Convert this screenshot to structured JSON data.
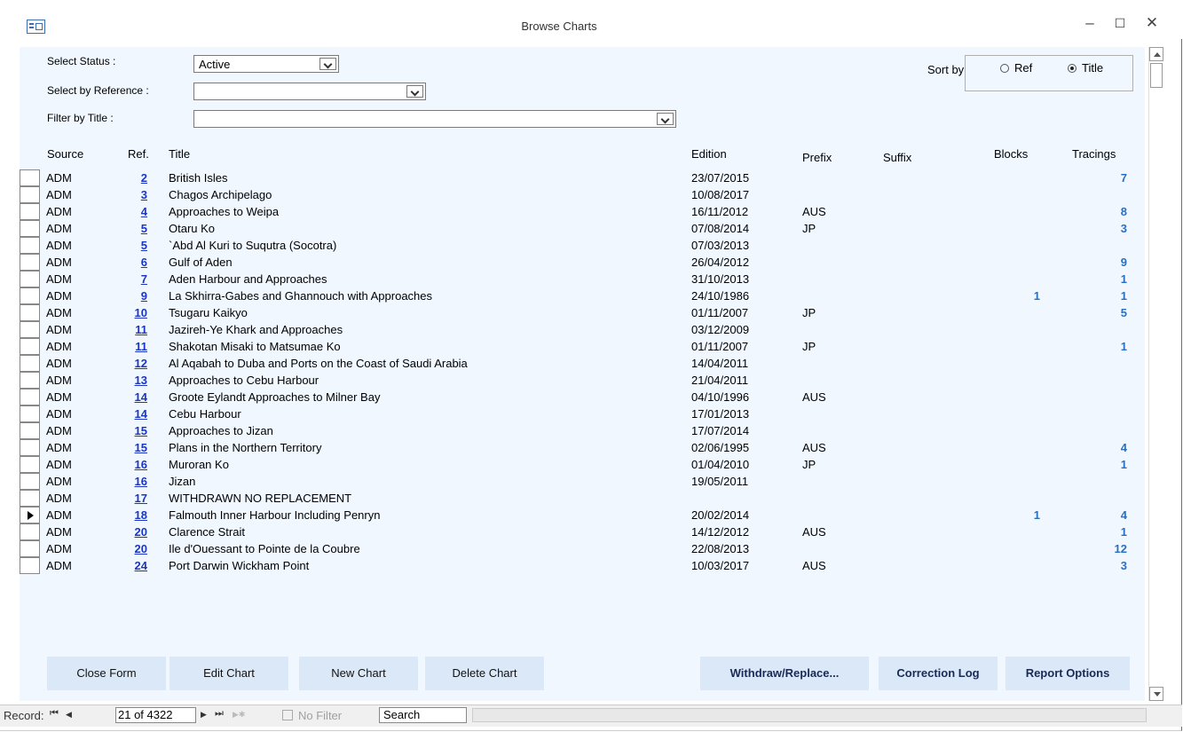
{
  "window": {
    "title": "Browse Charts",
    "minimize": "–",
    "maximize": "☐",
    "close": "✕"
  },
  "filters": {
    "status_label": "Select Status :",
    "status_value": "Active",
    "reference_label": "Select by Reference :",
    "reference_value": "",
    "title_label": "Filter by Title :",
    "title_value": "",
    "sort_label": "Sort by",
    "sort_ref": "Ref",
    "sort_title": "Title",
    "sort_selected": "Title"
  },
  "columns": {
    "source": "Source",
    "ref": "Ref.",
    "title": "Title",
    "edition": "Edition",
    "prefix": "Prefix",
    "suffix": "Suffix",
    "blocks": "Blocks",
    "tracings": "Tracings"
  },
  "rows": [
    {
      "source": "ADM",
      "ref": "2",
      "title": "British Isles",
      "edition": "23/07/2015",
      "prefix": "",
      "blocks": "",
      "tracings": "7"
    },
    {
      "source": "ADM",
      "ref": "3",
      "title": "Chagos Archipelago",
      "edition": "10/08/2017",
      "prefix": "",
      "blocks": "",
      "tracings": ""
    },
    {
      "source": "ADM",
      "ref": "4",
      "title": "Approaches to Weipa",
      "edition": "16/11/2012",
      "prefix": "AUS",
      "blocks": "",
      "tracings": "8"
    },
    {
      "source": "ADM",
      "ref": "5",
      "title": "Otaru Ko",
      "edition": "07/08/2014",
      "prefix": "JP",
      "blocks": "",
      "tracings": "3"
    },
    {
      "source": "ADM",
      "ref": "5",
      "title": "`Abd Al Kuri to Suqutra (Socotra)",
      "edition": "07/03/2013",
      "prefix": "",
      "blocks": "",
      "tracings": ""
    },
    {
      "source": "ADM",
      "ref": "6",
      "title": "Gulf of Aden",
      "edition": "26/04/2012",
      "prefix": "",
      "blocks": "",
      "tracings": "9"
    },
    {
      "source": "ADM",
      "ref": "7",
      "title": "Aden Harbour and Approaches",
      "edition": "31/10/2013",
      "prefix": "",
      "blocks": "",
      "tracings": "1"
    },
    {
      "source": "ADM",
      "ref": "9",
      "title": "La Skhirra-Gabes and Ghannouch with Approaches",
      "edition": "24/10/1986",
      "prefix": "",
      "blocks": "1",
      "tracings": "1"
    },
    {
      "source": "ADM",
      "ref": "10",
      "title": "Tsugaru Kaikyo",
      "edition": "01/11/2007",
      "prefix": "JP",
      "blocks": "",
      "tracings": "5"
    },
    {
      "source": "ADM",
      "ref": "11",
      "title": "Jazireh-Ye Khark and Approaches",
      "edition": "03/12/2009",
      "prefix": "",
      "blocks": "",
      "tracings": ""
    },
    {
      "source": "ADM",
      "ref": "11",
      "title": "Shakotan Misaki to Matsumae Ko",
      "edition": "01/11/2007",
      "prefix": "JP",
      "blocks": "",
      "tracings": "1"
    },
    {
      "source": "ADM",
      "ref": "12",
      "title": "Al Aqabah to Duba and Ports on the Coast of Saudi Arabia",
      "edition": "14/04/2011",
      "prefix": "",
      "blocks": "",
      "tracings": ""
    },
    {
      "source": "ADM",
      "ref": "13",
      "title": "Approaches to Cebu Harbour",
      "edition": "21/04/2011",
      "prefix": "",
      "blocks": "",
      "tracings": ""
    },
    {
      "source": "ADM",
      "ref": "14",
      "title": "Groote Eylandt Approaches to Milner Bay",
      "edition": "04/10/1996",
      "prefix": "AUS",
      "blocks": "",
      "tracings": ""
    },
    {
      "source": "ADM",
      "ref": "14",
      "title": "Cebu Harbour",
      "edition": "17/01/2013",
      "prefix": "",
      "blocks": "",
      "tracings": ""
    },
    {
      "source": "ADM",
      "ref": "15",
      "title": "Approaches to Jizan",
      "edition": "17/07/2014",
      "prefix": "",
      "blocks": "",
      "tracings": ""
    },
    {
      "source": "ADM",
      "ref": "15",
      "title": "Plans in the Northern Territory",
      "edition": "02/06/1995",
      "prefix": "AUS",
      "blocks": "",
      "tracings": "4"
    },
    {
      "source": "ADM",
      "ref": "16",
      "title": "Muroran Ko",
      "edition": "01/04/2010",
      "prefix": "JP",
      "blocks": "",
      "tracings": "1"
    },
    {
      "source": "ADM",
      "ref": "16",
      "title": "Jizan",
      "edition": "19/05/2011",
      "prefix": "",
      "blocks": "",
      "tracings": ""
    },
    {
      "source": "ADM",
      "ref": "17",
      "title": "WITHDRAWN NO REPLACEMENT",
      "edition": "",
      "prefix": "",
      "blocks": "",
      "tracings": ""
    },
    {
      "source": "ADM",
      "ref": "18",
      "title": "Falmouth Inner Harbour Including Penryn",
      "edition": "20/02/2014",
      "prefix": "",
      "blocks": "1",
      "tracings": "4",
      "current": true
    },
    {
      "source": "ADM",
      "ref": "20",
      "title": "Clarence Strait",
      "edition": "14/12/2012",
      "prefix": "AUS",
      "blocks": "",
      "tracings": "1"
    },
    {
      "source": "ADM",
      "ref": "20",
      "title": "Ile d'Ouessant to Pointe de la Coubre",
      "edition": "22/08/2013",
      "prefix": "",
      "blocks": "",
      "tracings": "12"
    },
    {
      "source": "ADM",
      "ref": "24",
      "title": "Port Darwin Wickham Point",
      "edition": "10/03/2017",
      "prefix": "AUS",
      "blocks": "",
      "tracings": "3"
    }
  ],
  "buttons": {
    "close_form": "Close Form",
    "edit_chart": "Edit Chart",
    "new_chart": "New Chart",
    "delete_chart": "Delete Chart",
    "withdraw_replace": "Withdraw/Replace...",
    "correction_log": "Correction Log",
    "report_options": "Report Options"
  },
  "navigation": {
    "record_label": "Record:",
    "first": "⏮",
    "prev": "◀",
    "record_value": "21 of 4322",
    "next": "▶",
    "last": "⏭",
    "new": "▶✱",
    "no_filter": "No Filter",
    "search": "Search"
  },
  "colors": {
    "link": "#1b36c4",
    "count": "#2b6fbf",
    "form_bg": "#f0f7fe",
    "button_bg": "#dbe8f8"
  }
}
